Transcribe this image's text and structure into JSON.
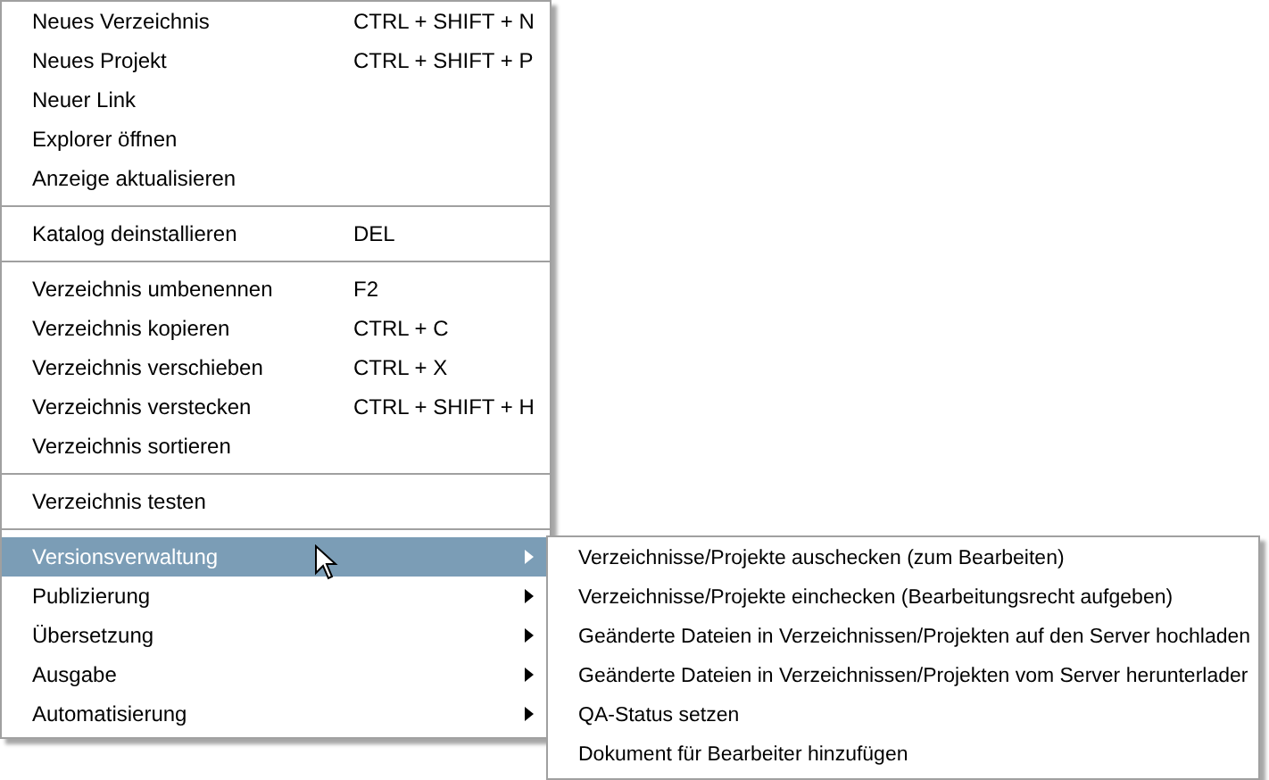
{
  "menu": {
    "sections": [
      {
        "items": [
          {
            "label": "Neues Verzeichnis",
            "shortcut": "CTRL + SHIFT + N",
            "has_submenu": false,
            "selected": false
          },
          {
            "label": "Neues Projekt",
            "shortcut": "CTRL + SHIFT + P",
            "has_submenu": false,
            "selected": false
          },
          {
            "label": "Neuer Link",
            "has_submenu": false,
            "selected": false
          },
          {
            "label": "Explorer öffnen",
            "has_submenu": false,
            "selected": false
          },
          {
            "label": "Anzeige aktualisieren",
            "has_submenu": false,
            "selected": false
          }
        ]
      },
      {
        "items": [
          {
            "label": "Katalog deinstallieren",
            "shortcut": "DEL",
            "has_submenu": false,
            "selected": false
          }
        ]
      },
      {
        "items": [
          {
            "label": "Verzeichnis umbenennen",
            "shortcut": "F2",
            "has_submenu": false,
            "selected": false
          },
          {
            "label": "Verzeichnis kopieren",
            "shortcut": "CTRL + C",
            "has_submenu": false,
            "selected": false
          },
          {
            "label": "Verzeichnis verschieben",
            "shortcut": "CTRL + X",
            "has_submenu": false,
            "selected": false
          },
          {
            "label": "Verzeichnis verstecken",
            "shortcut": "CTRL + SHIFT + H",
            "has_submenu": false,
            "selected": false
          },
          {
            "label": "Verzeichnis sortieren",
            "has_submenu": false,
            "selected": false
          }
        ]
      },
      {
        "items": [
          {
            "label": "Verzeichnis testen",
            "has_submenu": false,
            "selected": false
          }
        ]
      },
      {
        "items": [
          {
            "label": "Versionsverwaltung",
            "has_submenu": true,
            "selected": true
          },
          {
            "label": "Publizierung",
            "has_submenu": true,
            "selected": false
          },
          {
            "label": "Übersetzung",
            "has_submenu": true,
            "selected": false
          },
          {
            "label": "Ausgabe",
            "has_submenu": true,
            "selected": false
          },
          {
            "label": "Automatisierung",
            "has_submenu": true,
            "selected": false
          }
        ]
      }
    ]
  },
  "submenu": {
    "items": [
      {
        "label": "Verzeichnisse/Projekte auschecken (zum Bearbeiten)"
      },
      {
        "label": "Verzeichnisse/Projekte einchecken (Bearbeitungsrecht aufgeben)"
      },
      {
        "label": "Geänderte Dateien in Verzeichnissen/Projekten auf den Server hochladen"
      },
      {
        "label": "Geänderte Dateien in Verzeichnissen/Projekten vom Server herunterlader"
      },
      {
        "label": "QA-Status setzen"
      },
      {
        "label": "Dokument für Bearbeiter hinzufügen"
      }
    ]
  }
}
